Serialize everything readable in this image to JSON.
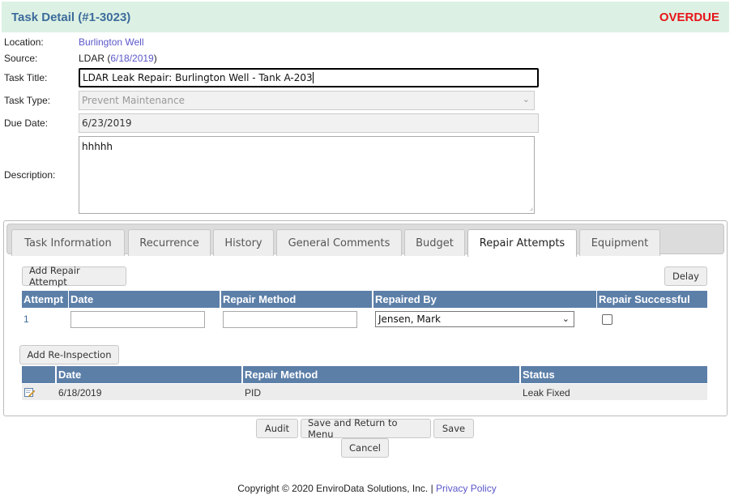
{
  "header": {
    "title": "Task Detail (#1-3023)",
    "status": "OVERDUE"
  },
  "fields": {
    "location_label": "Location:",
    "location_value": "Burlington Well",
    "source_label": "Source:",
    "source_prefix": "LDAR (",
    "source_link": "6/18/2019",
    "source_suffix": ")",
    "task_title_label": "Task Title:",
    "task_title_value": "LDAR Leak Repair: Burlington Well - Tank A-203",
    "task_type_label": "Task Type:",
    "task_type_value": "Prevent Maintenance",
    "due_date_label": "Due Date:",
    "due_date_value": "6/23/2019",
    "description_label": "Description:",
    "description_value": "hhhhh"
  },
  "tabs": [
    {
      "label": "Task Information"
    },
    {
      "label": "Recurrence"
    },
    {
      "label": "History"
    },
    {
      "label": "General Comments"
    },
    {
      "label": "Budget"
    },
    {
      "label": "Repair Attempts"
    },
    {
      "label": "Equipment"
    }
  ],
  "repair": {
    "add_label": "Add Repair Attempt",
    "delay_label": "Delay",
    "headers": {
      "attempt": "Attempt",
      "date": "Date",
      "method": "Repair Method",
      "by": "Repaired By",
      "successful": "Repair Successful"
    },
    "row": {
      "attempt": "1",
      "repaired_by": "Jensen, Mark"
    }
  },
  "reinspection": {
    "add_label": "Add Re-Inspection",
    "headers": {
      "date": "Date",
      "method": "Repair Method",
      "status": "Status"
    },
    "row": {
      "date": "6/18/2019",
      "method": "PID",
      "status": "Leak Fixed"
    }
  },
  "actions": {
    "audit": "Audit",
    "save_return": "Save and Return to Menu",
    "save": "Save",
    "cancel": "Cancel"
  },
  "footer": {
    "copyright": "Copyright © 2020 EnviroData Solutions, Inc. | ",
    "privacy": "Privacy Policy"
  },
  "colors": {
    "header_bg": "#dcf1e3",
    "title": "#3d6b9c",
    "overdue": "#e8141a",
    "table_header": "#5c7fa8",
    "link": "#5b57c9"
  }
}
